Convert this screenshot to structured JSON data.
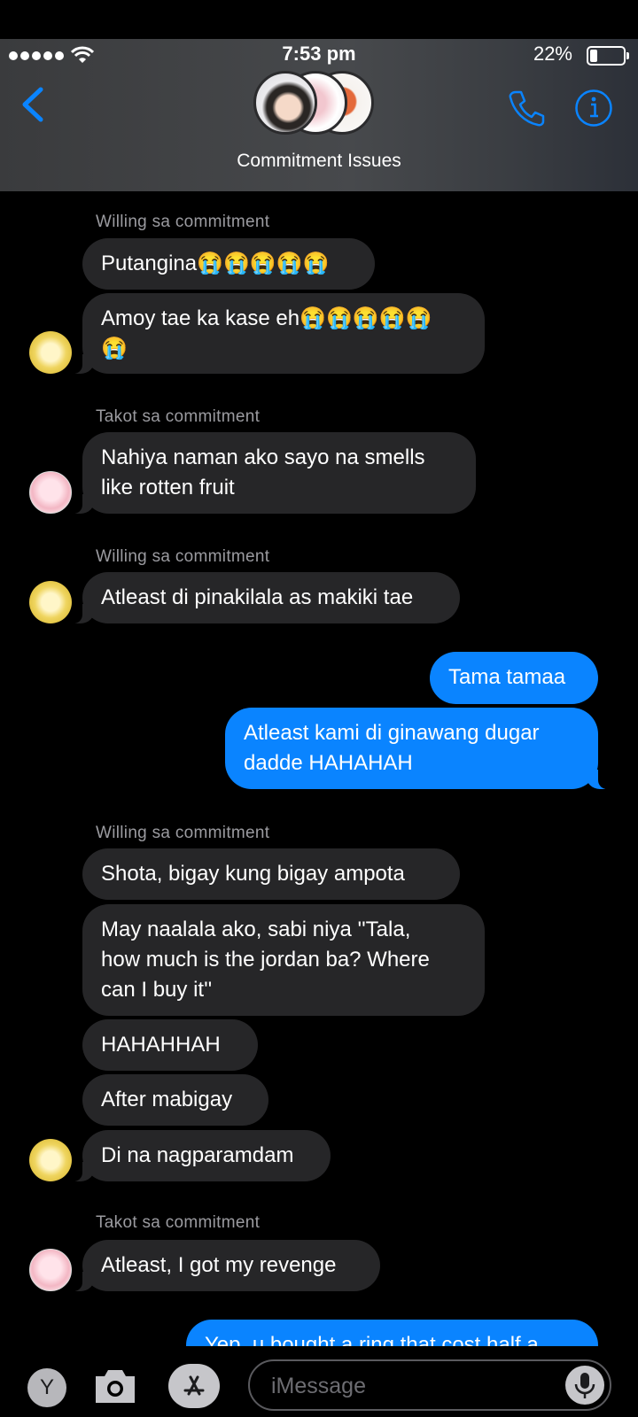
{
  "status_bar": {
    "time": "7:53 pm",
    "battery_percent": "22%",
    "battery_level": 0.22
  },
  "header": {
    "title": "Commitment Issues",
    "back_icon": "chevron-left-icon",
    "call_icon": "phone-icon",
    "info_icon": "info-icon"
  },
  "colors": {
    "accent": "#0A84FF",
    "incoming_bubble": "#262628",
    "outgoing_bubble": "#0A84FF",
    "background": "#000000"
  },
  "messages": [
    {
      "sender": "Willing sa commitment"
    },
    {
      "text": "Putangina😭😭😭😭😭"
    },
    {
      "text": "Amoy tae ka kase eh😭😭😭😭😭\n😭"
    },
    {
      "sender": "Takot sa commitment"
    },
    {
      "text": "Nahiya naman ako sayo na smells\nlike rotten fruit"
    },
    {
      "sender": "Willing sa commitment"
    },
    {
      "text": "Atleast di pinakilala as makiki tae"
    },
    {
      "text": "Tama tamaa"
    },
    {
      "text": "Atleast kami di ginawang dugar\ndadde HAHAHAH"
    },
    {
      "sender": "Willing sa commitment"
    },
    {
      "text": "Shota, bigay kung bigay ampota"
    },
    {
      "text": "May naalala ako, sabi niya ''Tala,\nhow much is the jordan ba? Where\ncan I buy it''"
    },
    {
      "text": "HAHAHHAH"
    },
    {
      "text": "After mabigay"
    },
    {
      "text": "Di na nagparamdam"
    },
    {
      "sender": "Takot sa commitment"
    },
    {
      "text": "Atleast, I got my revenge"
    },
    {
      "text": "Yep, u bought a ring that cost half a"
    }
  ],
  "composer": {
    "placeholder": "iMessage",
    "app_button_label": "Y"
  }
}
